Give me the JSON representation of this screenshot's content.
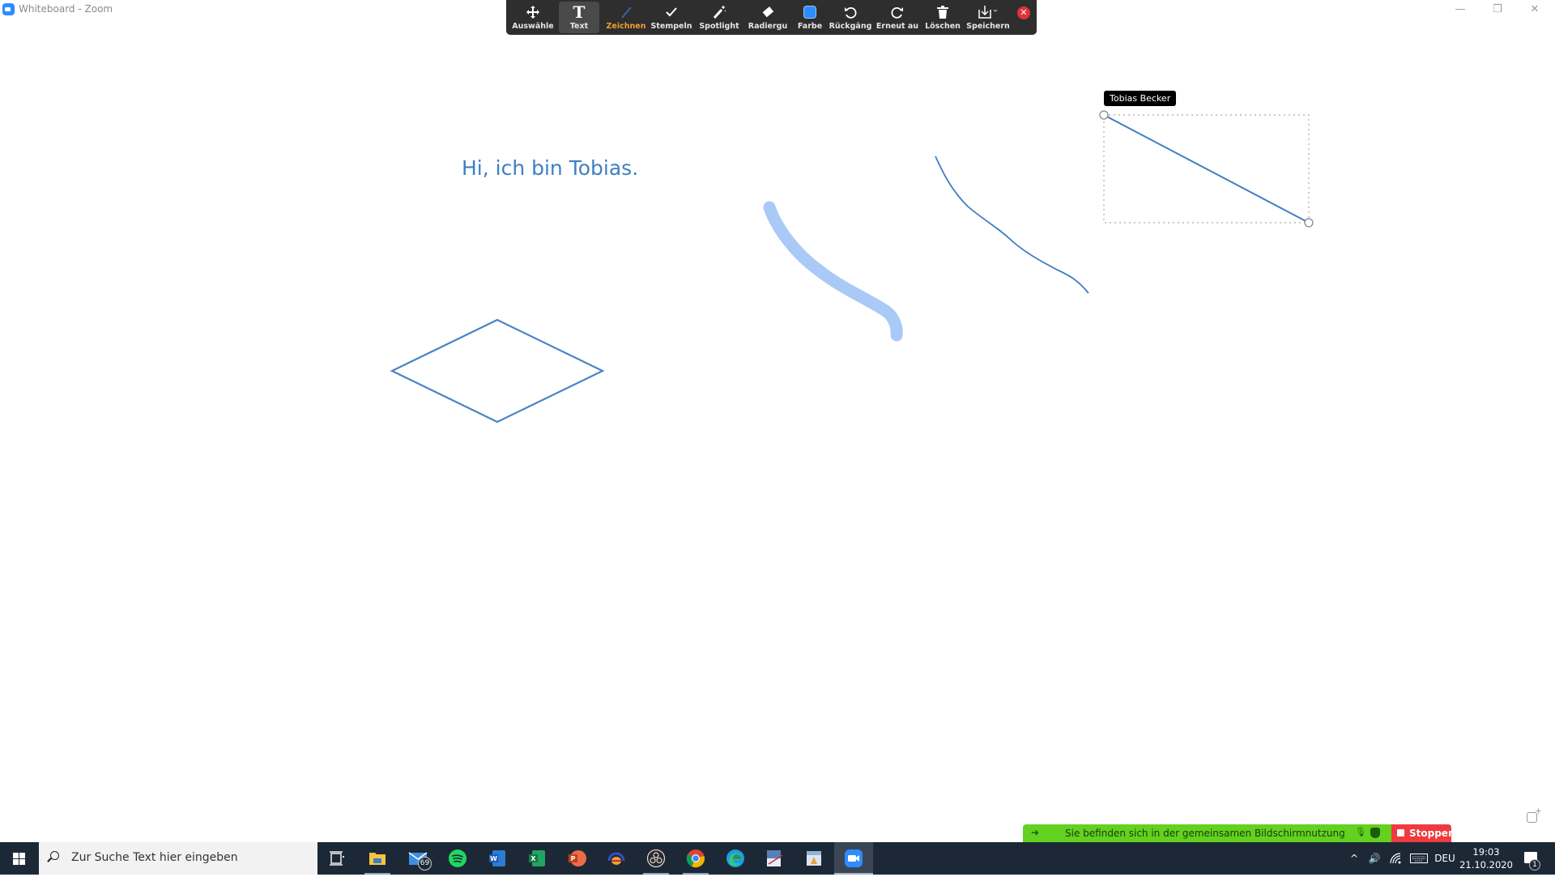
{
  "window": {
    "title": "Whiteboard - Zoom",
    "controls": {
      "minimize": "—",
      "restore": "❐",
      "close": "✕"
    }
  },
  "toolbar": {
    "tools": [
      {
        "id": "select",
        "label": "Auswähle",
        "icon": "move-arrows-icon"
      },
      {
        "id": "text",
        "label": "Text",
        "icon": "text-t-icon",
        "active": true
      },
      {
        "id": "draw",
        "label": "Zeichnen",
        "icon": "pen-line-icon",
        "selected": true
      },
      {
        "id": "stamp",
        "label": "Stempeln",
        "icon": "checkmark-icon"
      },
      {
        "id": "spotlight",
        "label": "Spotlight",
        "icon": "magic-wand-icon"
      },
      {
        "id": "eraser",
        "label": "Radiergu",
        "icon": "eraser-icon"
      },
      {
        "id": "color",
        "label": "Farbe",
        "icon": "color-swatch-icon"
      },
      {
        "id": "undo",
        "label": "Rückgäng",
        "icon": "undo-icon"
      },
      {
        "id": "redo",
        "label": "Erneut au",
        "icon": "redo-icon"
      },
      {
        "id": "delete",
        "label": "Löschen",
        "icon": "trash-icon"
      },
      {
        "id": "save",
        "label": "Speichern",
        "icon": "download-icon"
      }
    ],
    "close_symbol": "✕",
    "current_color": "#2d8cff"
  },
  "canvas": {
    "text_annotation": "Hi, ich bin Tobias.",
    "author_tag": "Tobias Becker",
    "stroke_color": "#3f7fc4",
    "highlighter_color": "#a9c9f7"
  },
  "share_bar": {
    "message": "Sie befinden sich in der gemeinsamen Bildschirmnutzung",
    "stop_label": "Stoppen",
    "color": "#63d11f",
    "stop_color": "#ef3a3f"
  },
  "taskbar": {
    "search_placeholder": "Zur Suche Text hier eingeben",
    "apps": [
      {
        "name": "task-view"
      },
      {
        "name": "file-explorer"
      },
      {
        "name": "mail",
        "badge": "69"
      },
      {
        "name": "spotify"
      },
      {
        "name": "word"
      },
      {
        "name": "excel"
      },
      {
        "name": "powerpoint"
      },
      {
        "name": "audio-app"
      },
      {
        "name": "obs"
      },
      {
        "name": "chrome"
      },
      {
        "name": "edge"
      },
      {
        "name": "screen-app"
      },
      {
        "name": "document-app"
      },
      {
        "name": "zoom",
        "focused": true
      }
    ],
    "tray": {
      "chevron": "^",
      "volume": "🔊",
      "language": "DEU",
      "time": "19:03",
      "date": "21.10.2020",
      "notification_count": "1"
    }
  }
}
